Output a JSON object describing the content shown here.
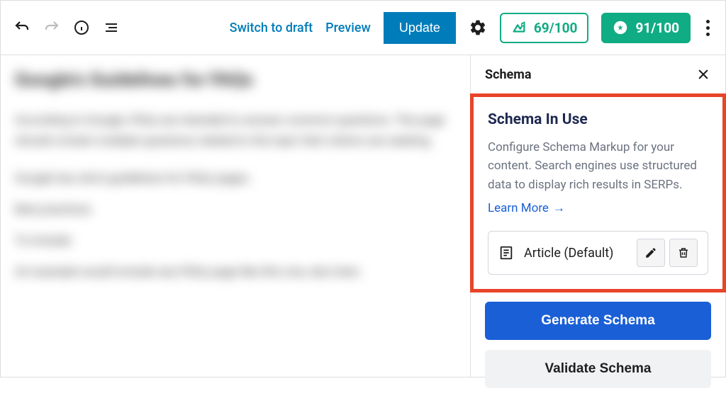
{
  "toolbar": {
    "switch_to_draft": "Switch to draft",
    "preview": "Preview",
    "update": "Update"
  },
  "scores": {
    "seo": "69/100",
    "readability": "91/100"
  },
  "sidebar": {
    "title": "Schema",
    "panel_title": "Schema In Use",
    "panel_desc": "Configure Schema Markup for your content. Search engines use structured data to display rich results in SERPs.",
    "learn_more": "Learn More",
    "schema_item": "Article (Default)",
    "generate_btn": "Generate Schema",
    "validate_btn": "Validate Schema"
  }
}
